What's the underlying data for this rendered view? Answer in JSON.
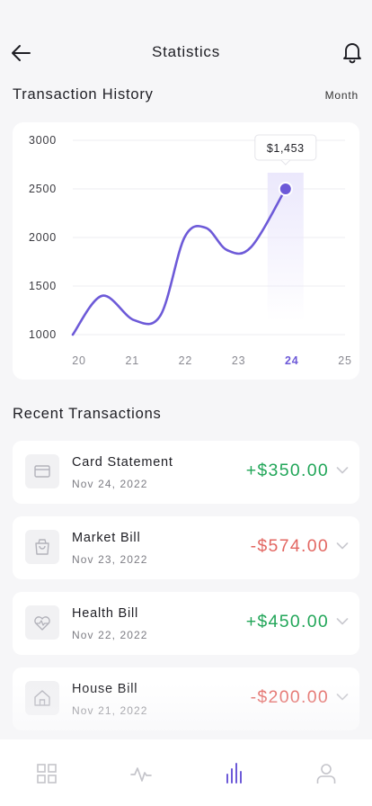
{
  "header": {
    "title": "Statistics"
  },
  "history": {
    "title": "Transaction History",
    "period": "Month"
  },
  "chart_data": {
    "type": "line",
    "x": [
      20,
      21,
      22,
      23,
      24,
      25
    ],
    "x_tick_labels": [
      "20",
      "21",
      "22",
      "23",
      "24",
      "25"
    ],
    "y_tick_labels": [
      "3000",
      "2500",
      "2000",
      "1500",
      "1000"
    ],
    "ylim": [
      1000,
      3000
    ],
    "xlim": [
      20,
      25
    ],
    "grid": true,
    "series": [
      {
        "points": [
          {
            "x": 20.0,
            "y": 1000
          },
          {
            "x": 20.55,
            "y": 1400
          },
          {
            "x": 21.15,
            "y": 1150
          },
          {
            "x": 21.65,
            "y": 1200
          },
          {
            "x": 22.1,
            "y": 2000
          },
          {
            "x": 22.5,
            "y": 2100
          },
          {
            "x": 22.9,
            "y": 1870
          },
          {
            "x": 23.35,
            "y": 1900
          },
          {
            "x": 24.0,
            "y": 2500
          }
        ]
      }
    ],
    "selected": {
      "x": 24,
      "label": "24",
      "tooltip": "$1,453"
    },
    "colors": {
      "line": "#6d5ad8",
      "grid": "#ececf0",
      "axis_text": "#3a3a40",
      "tick_x": "#8a8a92"
    }
  },
  "recent": {
    "title": "Recent Transactions",
    "items": [
      {
        "name": "Card Statement",
        "date": "Nov 24, 2022",
        "amount": "+$350.00",
        "kind": "pos",
        "icon": "card-icon"
      },
      {
        "name": "Market Bill",
        "date": "Nov 23, 2022",
        "amount": "-$574.00",
        "kind": "neg",
        "icon": "bag-icon"
      },
      {
        "name": "Health Bill",
        "date": "Nov 22, 2022",
        "amount": "+$450.00",
        "kind": "pos",
        "icon": "heart-pulse-icon"
      },
      {
        "name": "House Bill",
        "date": "Nov 21, 2022",
        "amount": "-$200.00",
        "kind": "neg",
        "icon": "house-icon"
      }
    ]
  },
  "tabs": [
    {
      "icon": "grid-icon",
      "active": false
    },
    {
      "icon": "activity-icon",
      "active": false
    },
    {
      "icon": "bar-chart-icon",
      "active": true
    },
    {
      "icon": "user-icon",
      "active": false
    }
  ],
  "colors": {
    "accent": "#6d5ad8",
    "positive": "#22a659",
    "negative": "#e36762",
    "background": "#f6f6f8",
    "card": "#ffffff"
  }
}
